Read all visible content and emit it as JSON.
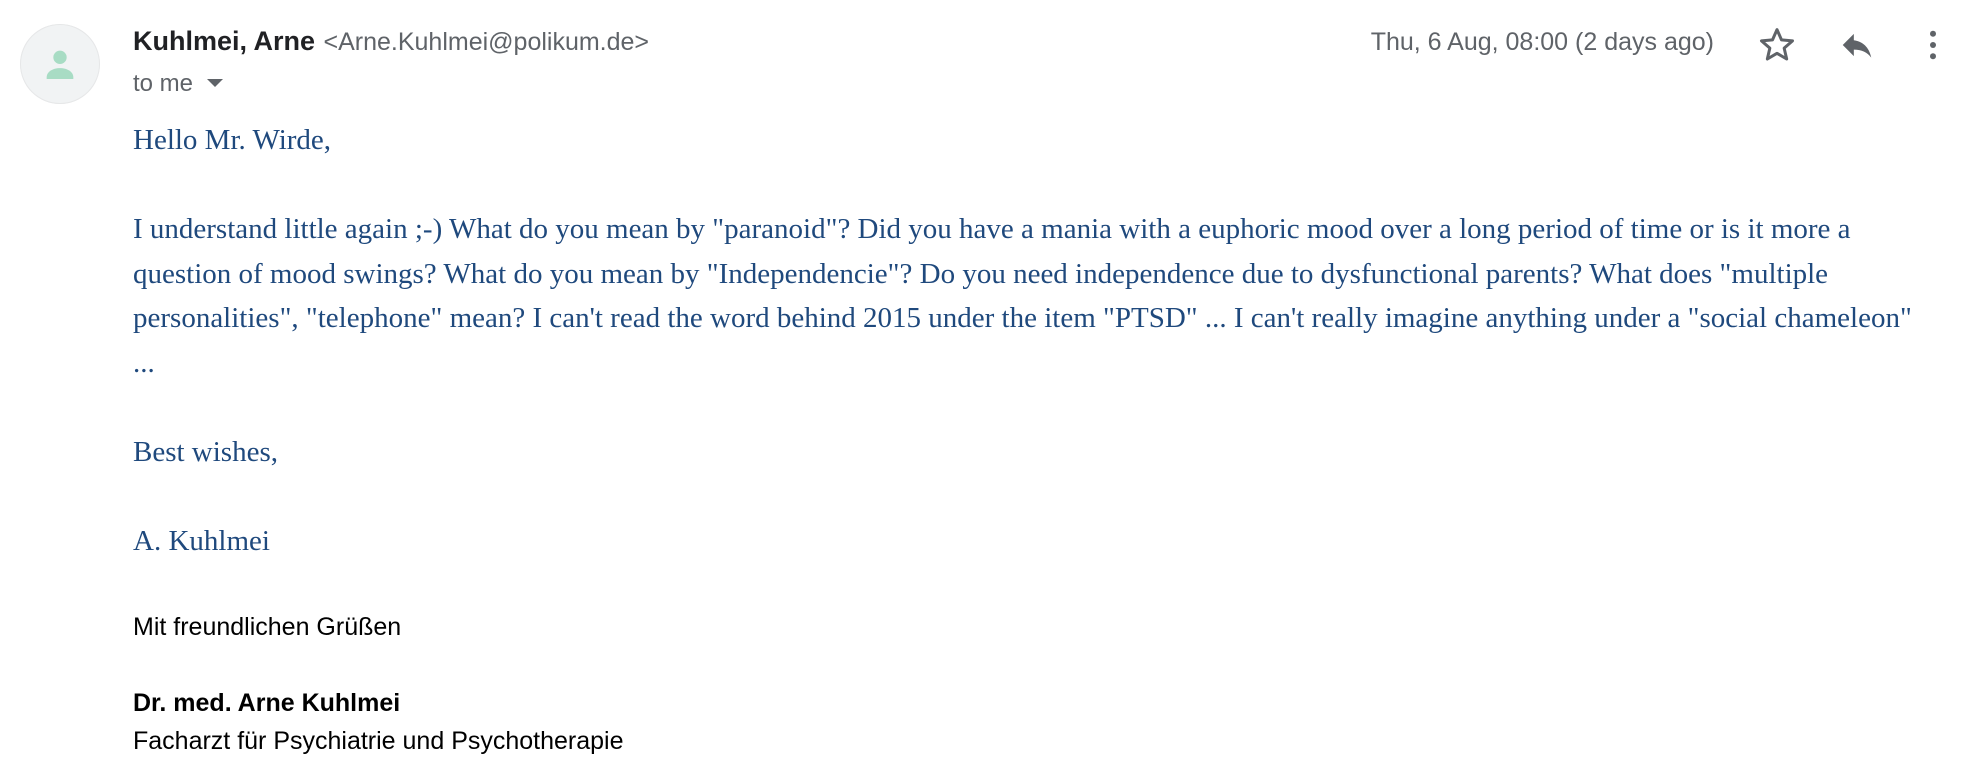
{
  "sender": {
    "name": "Kuhlmei, Arne",
    "email": "<Arne.Kuhlmei@polikum.de>",
    "avatar_icon": "person-icon"
  },
  "recipient": {
    "label": "to me"
  },
  "date": "Thu, 6 Aug, 08:00 (2 days ago)",
  "actions": {
    "star_icon": "star-outline-icon",
    "reply_icon": "reply-icon",
    "more_icon": "more-vert-icon"
  },
  "body": {
    "greeting": "Hello Mr. Wirde,",
    "paragraph": "I understand little again ;-) What do you mean by \"paranoid\"? Did you have a mania with a euphoric mood over a long period of time or is it more a question of mood swings? What do you mean by \"Independencie\"? Do you need independence due to dysfunctional parents? What does \"multiple personalities\", \"telephone\" mean? I can't read the word behind 2015 under the item \"PTSD\" ... I can't really imagine anything under a \"social chameleon\" ...",
    "closing": "Best wishes,",
    "signoff": "A. Kuhlmei"
  },
  "signature": {
    "greeting": "Mit freundlichen Grüßen",
    "name": "Dr. med. Arne Kuhlmei",
    "title": "Facharzt für Psychiatrie und Psychotherapie"
  },
  "colors": {
    "body_text": "#1f497d",
    "header_gray": "#5f6368",
    "avatar_icon": "#a8dcc4"
  }
}
